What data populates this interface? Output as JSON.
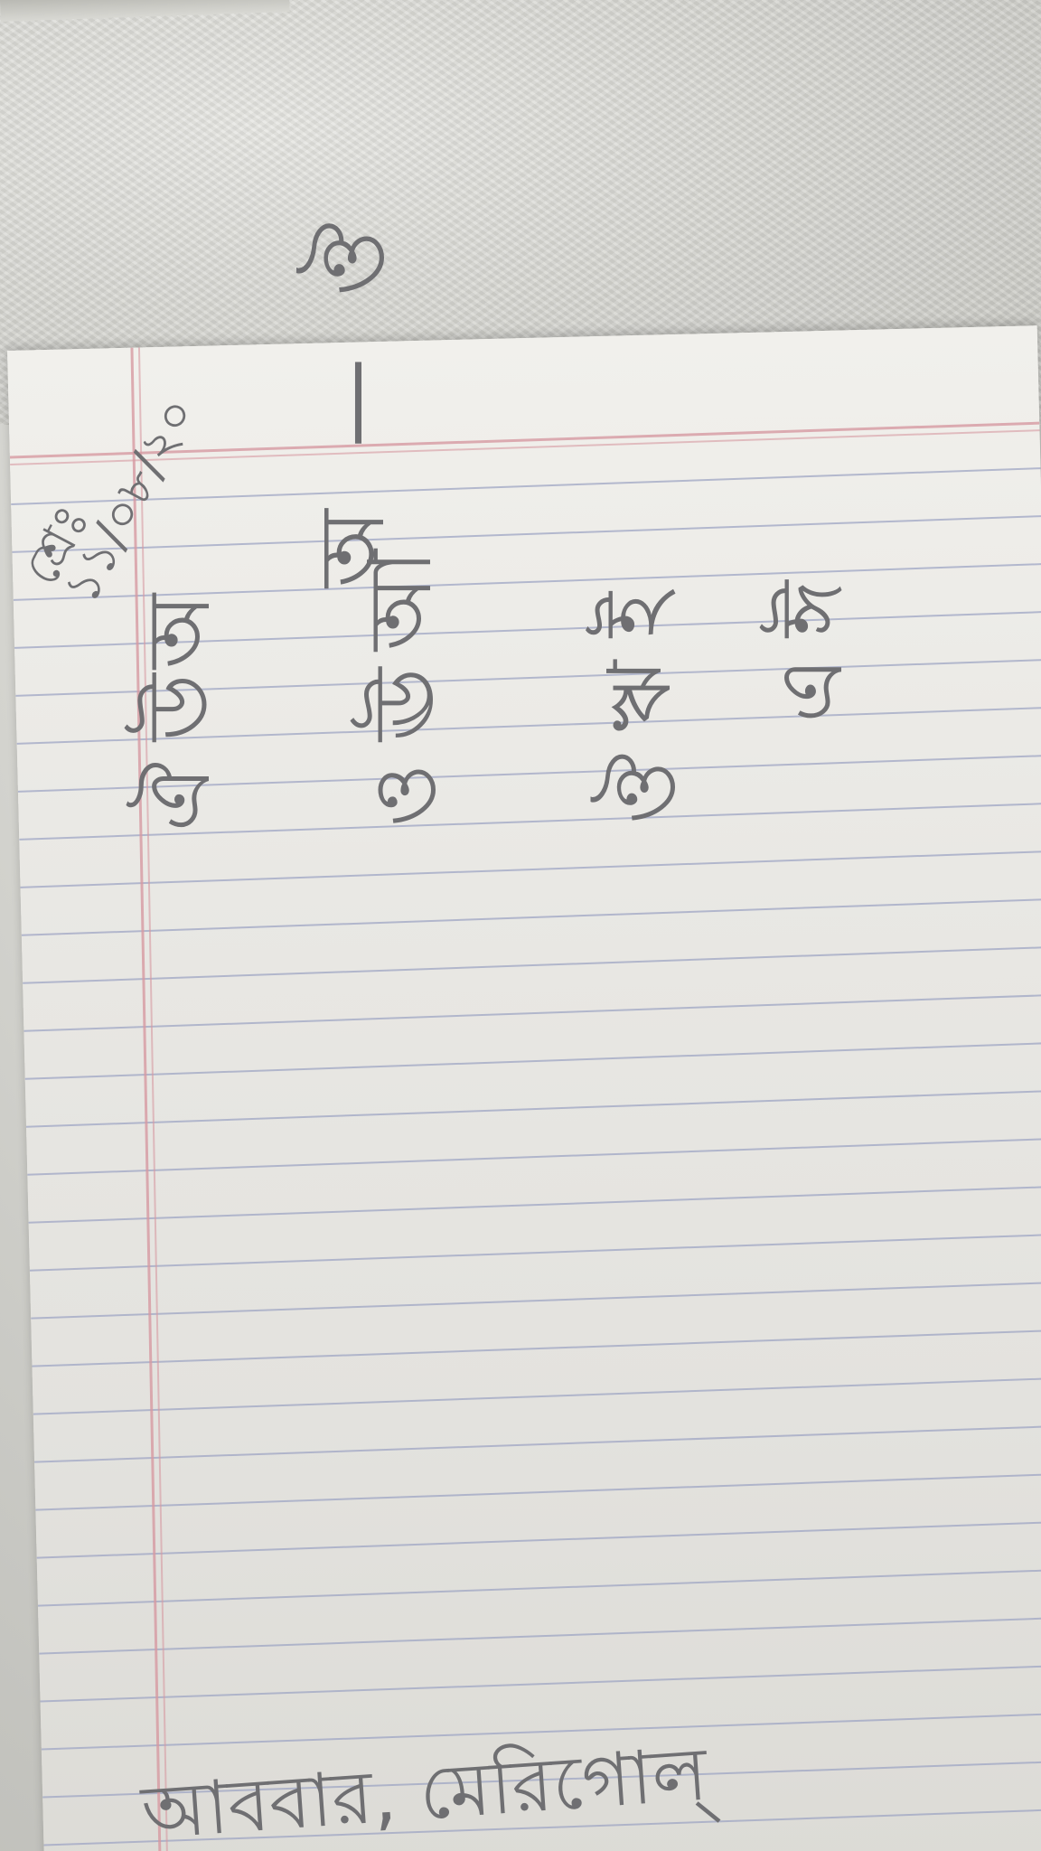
{
  "date": {
    "line1": "শ্রেঃ",
    "line2": "১১/০৮/২০"
  },
  "heading": "অ — ঔ",
  "vowels": [
    [
      "অ",
      "আ",
      "ই",
      "ঈ"
    ],
    [
      "উ",
      "ঊ",
      "ঋ",
      "এ"
    ],
    [
      "ঐ",
      "ও",
      "ঔ",
      ""
    ]
  ],
  "footer": "আববার, মেরিগোল্‌"
}
